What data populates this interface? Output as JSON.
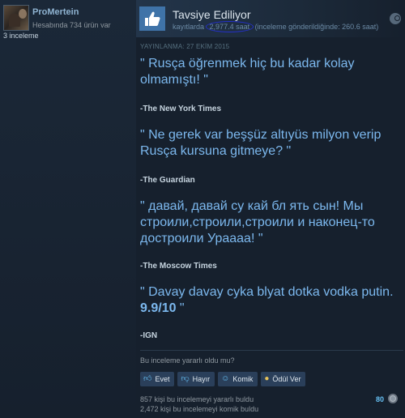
{
  "author": {
    "name": "ProMertein",
    "owned": "Hesabında 734 ürün var",
    "reviews": "3 inceleme"
  },
  "review": {
    "verdict": "Tavsiye Ediliyor",
    "hours_prefix": "kayıtlarda",
    "hours_value": "2,977.4 saat",
    "hours_suffix": "(inceleme gönderildiğinde: 260.6 saat)",
    "posted": "YAYINLANMA: 27 EKİM 2015",
    "blocks": [
      {
        "quote": "\" Rusça öğrenmek hiç bu kadar kolay olmamıştı! \"",
        "source": "-The New York Times"
      },
      {
        "quote": "\" Ne gerek var beşşüz altıyüs milyon verip Rusça kursuna gitmeye? \"",
        "source": "-The Guardian"
      },
      {
        "quote": "\" давай, давай су кай бл ять сын! Мы строили,строили,строили и наконец-то достроили Ураааа! \"",
        "source": "-The Moscow Times"
      },
      {
        "quote_prefix": "\" Davay davay cyka blyat dotka vodka putin. ",
        "quote_bold": "9.9/10",
        "quote_suffix": " \"",
        "source": "-IGN"
      }
    ]
  },
  "feedback": {
    "question": "Bu inceleme yararlı oldu mu?",
    "buttons": {
      "yes": "Evet",
      "no": "Hayır",
      "funny": "Komik",
      "award": "Ödül Ver"
    },
    "helpful_count": "857 kişi bu incelemeyi yararlı buldu",
    "funny_count": "2,472 kişi bu incelemeyi komik buldu",
    "award_count": "80"
  },
  "icons": {
    "thumb": "thumbs-up-icon",
    "steam": "steam-icon",
    "award": "award-icon"
  },
  "colors": {
    "background": "#16202d",
    "accent": "#66c0f4",
    "quote": "#7cb8ee",
    "thumb_bg": "#3f73a8",
    "circle_annotation": "#2430c8"
  }
}
